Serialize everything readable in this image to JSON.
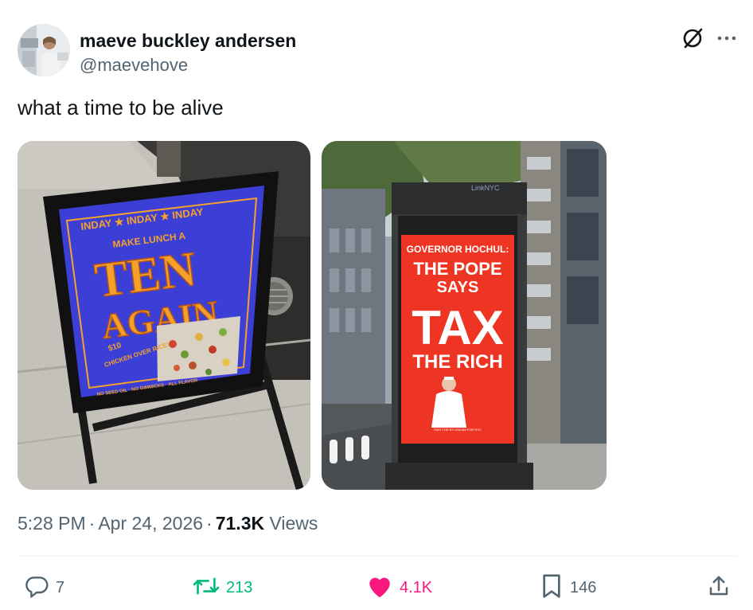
{
  "author": {
    "display_name": "maeve buckley andersen",
    "handle": "@maevehove"
  },
  "tweet": {
    "text": "what a time to be alive"
  },
  "media": [
    {
      "sign_banner": "INDAY ★ INDAY ★ INDAY",
      "sign_subhead": "MAKE LUNCH A",
      "sign_headline_1": "TEN",
      "sign_headline_2": "AGAIN",
      "sign_price": "$10",
      "sign_item": "CHICKEN OVER RICE!",
      "sign_footer": "NO SEED OIL · NO GIMMICKS · ALL FLAVOR"
    },
    {
      "kiosk_brand": "LinkNYC",
      "screen_line_1": "GOVERNOR HOCHUL:",
      "screen_line_2": "THE POPE",
      "screen_line_3": "SAYS",
      "screen_line_4": "TAX",
      "screen_line_5": "THE RICH",
      "screen_footer": "PAID FOR BY DREAM FOR NYC"
    }
  ],
  "meta": {
    "time": "5:28 PM",
    "dot": "·",
    "date": "Apr 24, 2026",
    "views_count": "71.3K",
    "views_label": "Views"
  },
  "actions": {
    "reply_count": "7",
    "retweet_count": "213",
    "like_count": "4.1K",
    "bookmark_count": "146"
  },
  "colors": {
    "text_primary": "#0f1419",
    "text_secondary": "#536471",
    "retweet": "#00ba7c",
    "like": "#f91880",
    "sign_blue": "#3b3fd6",
    "sign_orange": "#f4a12c",
    "screen_red": "#ee3524"
  },
  "icons": [
    "grok-icon",
    "more-icon",
    "reply-icon",
    "retweet-icon",
    "heart-icon",
    "bookmark-icon",
    "share-icon"
  ]
}
